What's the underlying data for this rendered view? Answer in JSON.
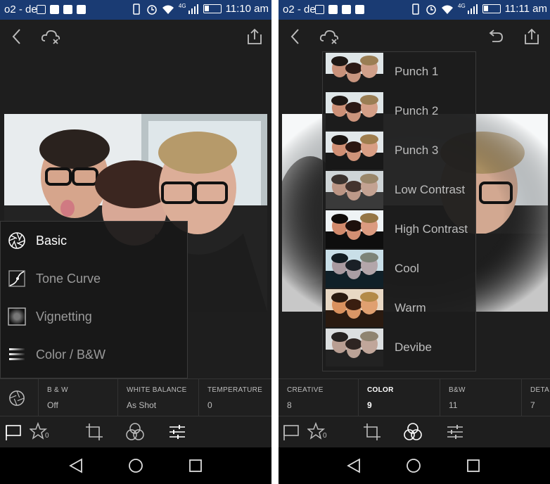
{
  "left": {
    "status": {
      "carrier": "o2 - de",
      "network": "4G",
      "time": "11:10 am"
    },
    "tools_menu": [
      {
        "label": "Basic",
        "icon": "aperture-icon",
        "active": true
      },
      {
        "label": "Tone Curve",
        "icon": "curve-icon",
        "active": false
      },
      {
        "label": "Vignetting",
        "icon": "vignette-icon",
        "active": false
      },
      {
        "label": "Color / B&W",
        "icon": "color-bars-icon",
        "active": false
      }
    ],
    "tabs": [
      {
        "title": "B & W",
        "value": "Off"
      },
      {
        "title": "WHITE BALANCE",
        "value": "As Shot"
      },
      {
        "title": "TEMPERATURE",
        "value": "0"
      }
    ],
    "toolbar": {
      "star_count": "0"
    }
  },
  "right": {
    "status": {
      "carrier": "o2 - de",
      "network": "4G",
      "time": "11:11 am"
    },
    "presets": [
      "Punch 1",
      "Punch 2",
      "Punch 3",
      "Low Contrast",
      "High Contrast",
      "Cool",
      "Warm",
      "Devibe"
    ],
    "tabs": [
      {
        "title": "CREATIVE",
        "value": "8",
        "active": false
      },
      {
        "title": "COLOR",
        "value": "9",
        "active": true
      },
      {
        "title": "B&W",
        "value": "11",
        "active": false
      },
      {
        "title": "DETAIL",
        "value": "7",
        "active": false
      }
    ],
    "toolbar": {
      "star_count": "0"
    }
  },
  "colors": {
    "status_bar": "#1a3b73",
    "background": "#1e1e1e",
    "text_muted": "#9a9a9a",
    "text_active": "#ffffff"
  }
}
